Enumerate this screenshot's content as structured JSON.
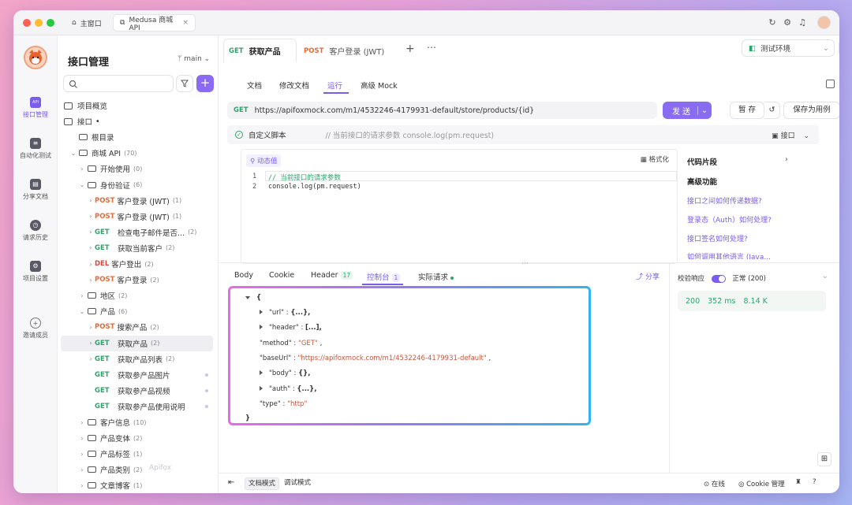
{
  "titlebar": {
    "tabs": [
      {
        "label": "主窗口",
        "icon": "home-icon"
      },
      {
        "label": "Medusa 商城 API",
        "icon": "external-link-icon",
        "close": "×"
      }
    ]
  },
  "rail": {
    "items": [
      {
        "label": "接口管理",
        "icon": "api-management-icon",
        "glyph": "API"
      },
      {
        "label": "自动化测试",
        "icon": "automation-icon",
        "glyph": "≡"
      },
      {
        "label": "分享文档",
        "icon": "share-doc-icon",
        "glyph": "▤"
      },
      {
        "label": "请求历史",
        "icon": "history-icon",
        "glyph": "◷"
      },
      {
        "label": "项目设置",
        "icon": "settings-icon",
        "glyph": "⚙"
      },
      {
        "label": "邀请成员",
        "icon": "invite-icon",
        "glyph": "+"
      }
    ]
  },
  "tree": {
    "title": "接口管理",
    "branch": "main",
    "search_placeholder": "",
    "add_label": "+",
    "rows": [
      {
        "label": "项目概览",
        "indent": 0,
        "kind": "overview"
      },
      {
        "label": "接口",
        "indent": 0,
        "kind": "section",
        "suffix": "•"
      },
      {
        "label": "根目录",
        "indent": 1,
        "kind": "folder"
      },
      {
        "label": "商城 API",
        "indent": 1,
        "kind": "folder",
        "open": true,
        "count": "(70)"
      },
      {
        "label": "开始使用",
        "indent": 2,
        "kind": "folder",
        "count": "(0)"
      },
      {
        "label": "身份验证",
        "indent": 2,
        "kind": "folder",
        "open": true,
        "count": "(6)"
      },
      {
        "label": "客户登录 (JWT)",
        "indent": 3,
        "kind": "api",
        "method": "POST",
        "count": "(1)"
      },
      {
        "label": "客户登录 (JWT)",
        "indent": 3,
        "kind": "api",
        "method": "POST",
        "count": "(1)"
      },
      {
        "label": "检查电子邮件是否...",
        "indent": 3,
        "kind": "api",
        "method": "GET",
        "count": "(2)"
      },
      {
        "label": "获取当前客户",
        "indent": 3,
        "kind": "api",
        "method": "GET",
        "count": "(2)"
      },
      {
        "label": "客户登出",
        "indent": 3,
        "kind": "api",
        "method": "DEL",
        "count": "(2)"
      },
      {
        "label": "客户登录",
        "indent": 3,
        "kind": "api",
        "method": "POST",
        "count": "(2)"
      },
      {
        "label": "地区",
        "indent": 2,
        "kind": "folder",
        "count": "(2)"
      },
      {
        "label": "产品",
        "indent": 2,
        "kind": "folder",
        "open": true,
        "count": "(6)"
      },
      {
        "label": "搜索产品",
        "indent": 3,
        "kind": "api",
        "method": "POST",
        "count": "(2)"
      },
      {
        "label": "获取产品",
        "indent": 3,
        "kind": "api",
        "method": "GET",
        "count": "(2)",
        "selected": true
      },
      {
        "label": "获取产品列表",
        "indent": 3,
        "kind": "api",
        "method": "GET",
        "count": "(2)"
      },
      {
        "label": "获取参产品图片",
        "indent": 3,
        "kind": "api",
        "method": "GET",
        "dot": true
      },
      {
        "label": "获取参产品视频",
        "indent": 3,
        "kind": "api",
        "method": "GET",
        "dot": true
      },
      {
        "label": "获取参产品使用说明",
        "indent": 3,
        "kind": "api",
        "method": "GET",
        "dot": true
      },
      {
        "label": "客户信息",
        "indent": 2,
        "kind": "folder",
        "count": "(10)"
      },
      {
        "label": "产品变体",
        "indent": 2,
        "kind": "folder",
        "count": "(2)"
      },
      {
        "label": "产品标签",
        "indent": 2,
        "kind": "folder",
        "count": "(1)"
      },
      {
        "label": "产品类别",
        "indent": 2,
        "kind": "folder",
        "count": "(2)"
      },
      {
        "label": "文章博客",
        "indent": 2,
        "kind": "folder",
        "count": "(1)"
      }
    ]
  },
  "request_tabs": [
    {
      "method": "GET",
      "label": "获取产品"
    },
    {
      "method": "POST",
      "label": "客户登录 (JWT)"
    }
  ],
  "env": {
    "label": "测试环境"
  },
  "sub_tabs": [
    "文档",
    "修改文档",
    "运行",
    "高级 Mock"
  ],
  "url": {
    "method": "GET",
    "value": "https://apifoxmock.com/m1/4532246-4179931-default/store/products/{id}"
  },
  "buttons": {
    "send": "发 送",
    "save": "暂 存",
    "save_case": "保存为用例"
  },
  "script": {
    "title": "自定义脚本",
    "comment": "// 当前接口的请求参数 console.log(pm.request)",
    "iface": "接口",
    "dyn": "动态值",
    "format": "格式化",
    "lines": [
      {
        "n": "1",
        "code": "// 当前接口的请求参数"
      },
      {
        "n": "2",
        "code": "console.log(pm.request)"
      }
    ]
  },
  "snippets": {
    "h1": "代码片段",
    "h2": "高级功能",
    "links": [
      "接口之间如何传递数据?",
      "登录态（Auth）如何处理?",
      "接口签名如何处理?",
      "如何调用其他语言 (Java..."
    ]
  },
  "response_tabs": [
    {
      "label": "Body"
    },
    {
      "label": "Cookie"
    },
    {
      "label": "Header",
      "badge": "17"
    },
    {
      "label": "控制台",
      "badge": "1"
    },
    {
      "label": "实际请求",
      "dot": true
    }
  ],
  "share": "分享",
  "console": {
    "open": "{",
    "close": "}",
    "lines": [
      {
        "key": "\"url\"",
        "val": "{...},",
        "collapsed": true
      },
      {
        "key": "\"header\"",
        "val": "[...],",
        "collapsed": true
      },
      {
        "key": "\"method\"",
        "str": "\"GET\"",
        "tail": ","
      },
      {
        "key": "\"baseUrl\"",
        "str": "\"https://apifoxmock.com/m1/4532246-4179931-default\"",
        "tail": ","
      },
      {
        "key": "\"body\"",
        "val": "{},",
        "collapsed": true
      },
      {
        "key": "\"auth\"",
        "val": "{...},",
        "collapsed": true
      },
      {
        "key": "\"type\"",
        "str": "\"http\"",
        "tail": ""
      }
    ]
  },
  "validation": {
    "label": "校验响应",
    "status": "正常 (200)"
  },
  "stats": {
    "code": "200",
    "time": "352 ms",
    "size": "8.14 K"
  },
  "footer": {
    "doc_mode": "文档模式",
    "debug_mode": "调试模式",
    "online": "在线",
    "cookie": "Cookie 管理",
    "watermark": "Apifox"
  }
}
